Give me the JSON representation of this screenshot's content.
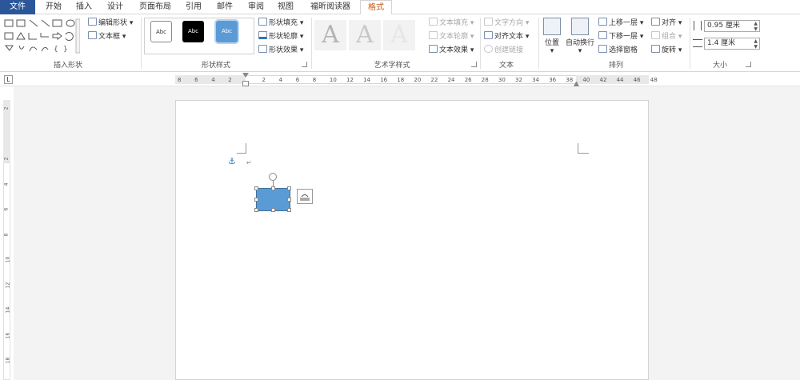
{
  "tabs": [
    {
      "label": "文件"
    },
    {
      "label": "开始"
    },
    {
      "label": "插入"
    },
    {
      "label": "设计"
    },
    {
      "label": "页面布局"
    },
    {
      "label": "引用"
    },
    {
      "label": "邮件"
    },
    {
      "label": "审阅"
    },
    {
      "label": "视图"
    },
    {
      "label": "福昕阅读器"
    },
    {
      "label": "格式"
    }
  ],
  "active_tab": "格式",
  "groups": {
    "insert_shapes": {
      "label": "插入形状",
      "edit_shape": "编辑形状",
      "text_box": "文本框"
    },
    "shape_styles": {
      "label": "形状样式",
      "sample_text": "Abc",
      "fill": "形状填充",
      "outline": "形状轮廓",
      "effects": "形状效果"
    },
    "wordart": {
      "label": "艺术字样式",
      "letter": "A",
      "text_fill": "文本填充",
      "text_outline": "文本轮廓",
      "text_effects": "文本效果"
    },
    "text": {
      "label": "文本",
      "direction": "文字方向",
      "align": "对齐文本",
      "link": "创建链接"
    },
    "arrange": {
      "label": "排列",
      "position": "位置",
      "wrap": "自动换行",
      "bring_forward": "上移一层",
      "send_backward": "下移一层",
      "selection_pane": "选择窗格",
      "align": "对齐",
      "group": "组合",
      "rotate": "旋转"
    },
    "size": {
      "label": "大小",
      "height": "0.95 厘米",
      "width": "1.4 厘米"
    }
  },
  "ruler_h": [
    "8",
    "6",
    "4",
    "2",
    "",
    "2",
    "4",
    "6",
    "8",
    "10",
    "12",
    "14",
    "16",
    "18",
    "20",
    "22",
    "24",
    "26",
    "28",
    "30",
    "32",
    "34",
    "36",
    "38",
    "40",
    "42",
    "44",
    "46",
    "48"
  ],
  "ruler_v": [
    "2",
    "",
    "2",
    "4",
    "6",
    "8",
    "10",
    "12",
    "14",
    "16",
    "18"
  ],
  "colors": {
    "file_tab": "#2b579a",
    "active_tab_text": "#c75b12",
    "shape_fill": "#5b9bd5"
  }
}
